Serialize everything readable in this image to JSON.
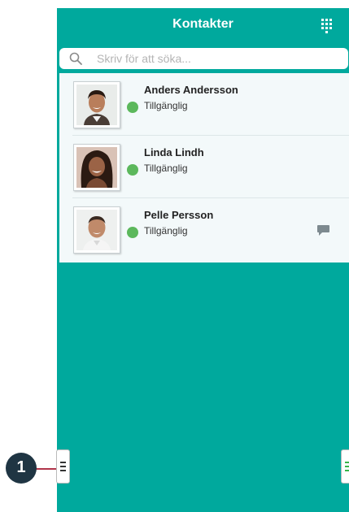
{
  "header": {
    "title": "Kontakter",
    "keypad_icon": "dialpad-icon"
  },
  "search": {
    "placeholder": "Skriv för att söka...",
    "value": ""
  },
  "contacts": [
    {
      "name": "Anders Andersson",
      "status": "Tillgänglig",
      "status_color": "#5cb85c",
      "has_message": false
    },
    {
      "name": "Linda Lindh",
      "status": "Tillgänglig",
      "status_color": "#5cb85c",
      "has_message": false
    },
    {
      "name": "Pelle Persson",
      "status": "Tillgänglig",
      "status_color": "#5cb85c",
      "has_message": true
    }
  ],
  "callout": {
    "number": "1",
    "color": "#1f3543",
    "line_color": "#b0344a"
  },
  "colors": {
    "background": "#00a99d",
    "list_background": "#f3f9fa",
    "menu_right_accent": "#3ab54a"
  }
}
